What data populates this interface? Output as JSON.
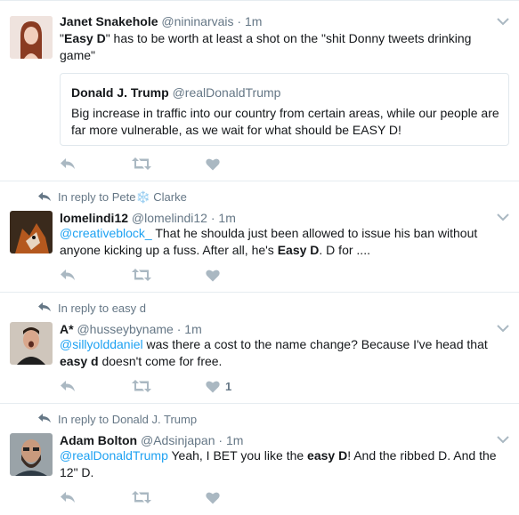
{
  "tweets": [
    {
      "name": "Janet Snakehole",
      "handle": "@nininarvais",
      "sep": "·",
      "time": "1m",
      "text": [
        {
          "t": "\"",
          "s": "plain"
        },
        {
          "t": "Easy D",
          "s": "bold"
        },
        {
          "t": "\" has to be worth at least a shot on the \"shit Donny tweets drinking game\"",
          "s": "plain"
        }
      ],
      "quote": {
        "name": "Donald J. Trump",
        "handle": "@realDonaldTrump",
        "text": "Big increase in traffic into our country from certain areas, while our people are far more vulnerable, as we wait for what should be EASY D!"
      },
      "like_count": ""
    },
    {
      "reply_context": "In reply to Pete❄️ Clarke",
      "name": "lomelindi12",
      "handle": "@lomelindi12",
      "sep": "·",
      "time": "1m",
      "text": [
        {
          "t": "@creativeblock_",
          "s": "mention"
        },
        {
          "t": " That he shoulda just been allowed to issue his ban without anyone kicking up a fuss. After all, he's ",
          "s": "plain"
        },
        {
          "t": "Easy D",
          "s": "bold"
        },
        {
          "t": ". D for ....",
          "s": "plain"
        }
      ],
      "like_count": ""
    },
    {
      "reply_context": "In reply to easy d",
      "name": "A*",
      "handle": "@husseybyname",
      "sep": "·",
      "time": "1m",
      "text": [
        {
          "t": "@sillyolddaniel",
          "s": "mention"
        },
        {
          "t": " was there a cost to the name change? Because I've head that ",
          "s": "plain"
        },
        {
          "t": "easy d",
          "s": "bold"
        },
        {
          "t": " doesn't come for free.",
          "s": "plain"
        }
      ],
      "like_count": "1"
    },
    {
      "reply_context": "In reply to Donald J. Trump",
      "name": "Adam Bolton",
      "handle": "@Adsinjapan",
      "sep": "·",
      "time": "1m",
      "text": [
        {
          "t": "@realDonaldTrump",
          "s": "mention"
        },
        {
          "t": " Yeah, I BET you like the ",
          "s": "plain"
        },
        {
          "t": "easy D",
          "s": "bold"
        },
        {
          "t": "! And the ribbed D. And the 12\" D.",
          "s": "plain"
        }
      ],
      "like_count": ""
    }
  ],
  "icons": {
    "reply": "reply-icon",
    "retweet": "retweet-icon",
    "like": "heart-icon",
    "caret": "chevron-down-icon",
    "reply_context": "reply-arrow-icon"
  },
  "colors": {
    "link": "#1da1f2",
    "muted": "#657786",
    "icon": "#aab8c2",
    "border": "#e6ecf0"
  }
}
